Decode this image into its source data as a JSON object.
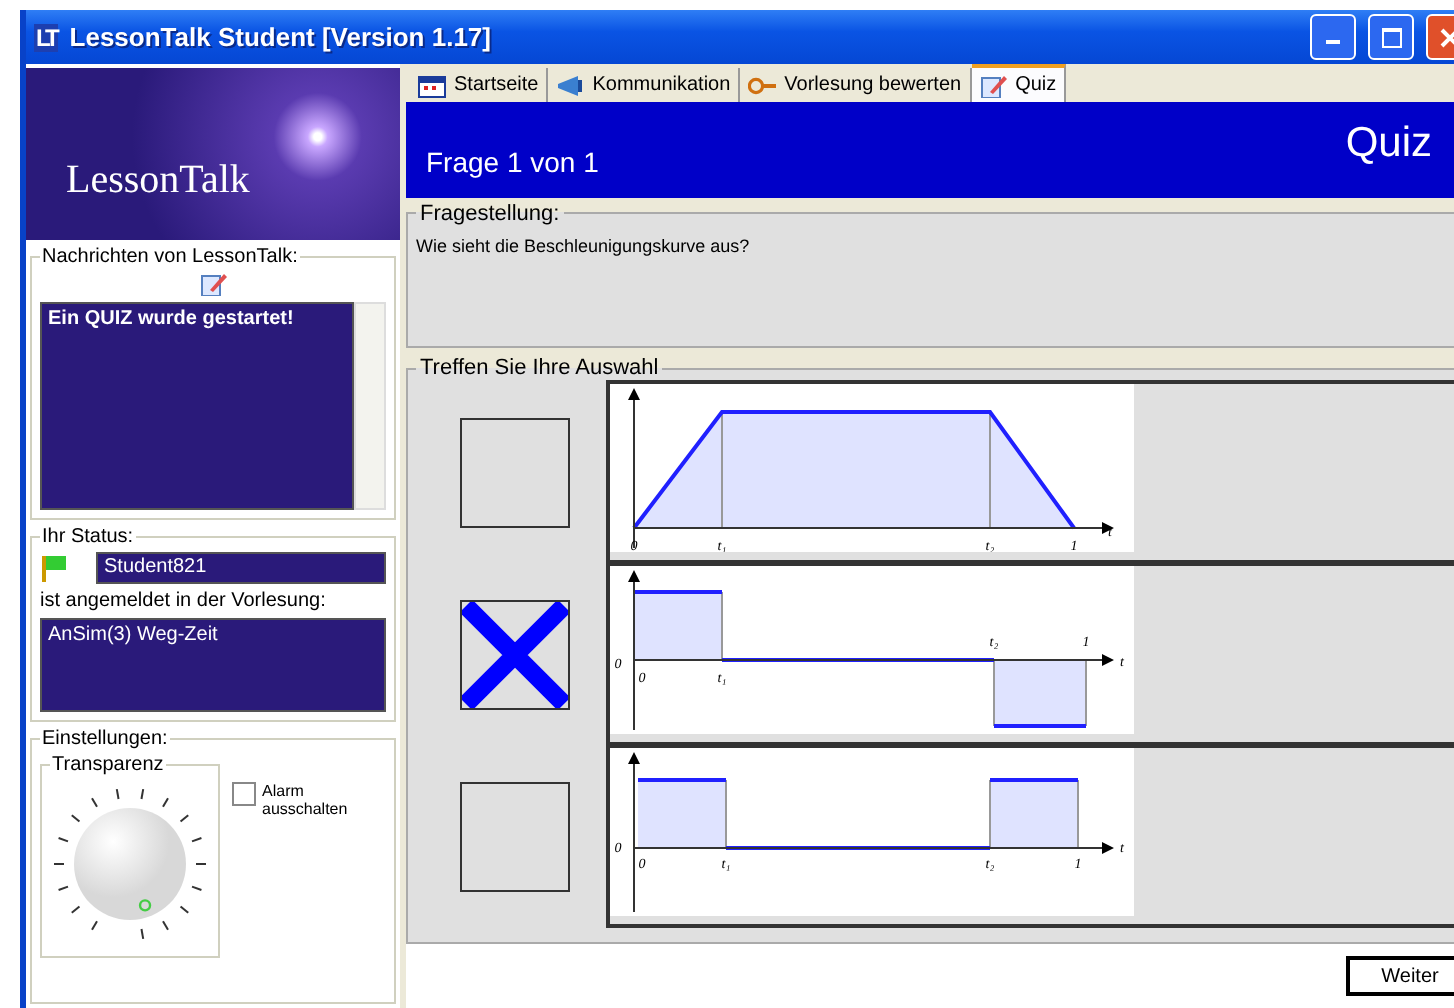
{
  "window": {
    "title": "LessonTalk Student [Version 1.17]",
    "app_icon": "LT"
  },
  "sidebar": {
    "logo": "LessonTalk",
    "messages": {
      "title": "Nachrichten von LessonTalk:",
      "text": "Ein QUIZ wurde gestartet!"
    },
    "status": {
      "title": "Ihr Status:",
      "user": "Student821",
      "caption": "ist angemeldet in der Vorlesung:",
      "lecture": "AnSim(3) Weg-Zeit"
    },
    "settings": {
      "title": "Einstellungen:",
      "dial_title": "Transparenz",
      "alarm": {
        "label": "Alarm ausschalten",
        "checked": false
      }
    }
  },
  "tabs": [
    {
      "label": "Startseite",
      "selected": false
    },
    {
      "label": "Kommunikation",
      "selected": false
    },
    {
      "label": "Vorlesung bewerten",
      "selected": false
    },
    {
      "label": "Quiz",
      "selected": true
    }
  ],
  "header": {
    "progress": "Frage 1 von 1",
    "title": "Quiz"
  },
  "question": {
    "title": "Fragestellung:",
    "text": "Wie sieht die Beschleunigungskurve aus?"
  },
  "answers": {
    "title": "Treffen Sie Ihre Auswahl",
    "options": [
      {
        "selected": false,
        "kind": "trapezoid",
        "labels": [
          "0",
          "t₁",
          "t₂",
          "1",
          "t"
        ]
      },
      {
        "selected": true,
        "kind": "pulse_negative",
        "labels": [
          "0",
          "0",
          "t₁",
          "t₂",
          "1",
          "t"
        ]
      },
      {
        "selected": false,
        "kind": "pulse_positive",
        "labels": [
          "0",
          "0",
          "t₁",
          "t₂",
          "1",
          "t"
        ]
      }
    ]
  },
  "next_button": "Weiter"
}
